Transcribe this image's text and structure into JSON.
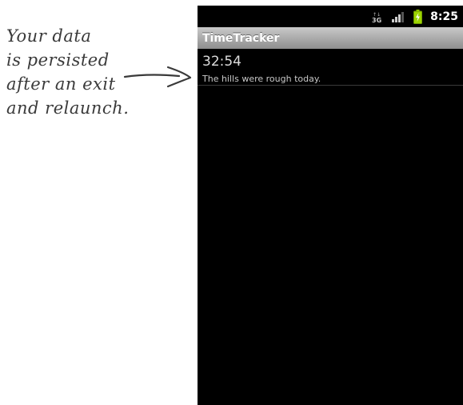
{
  "annotation": {
    "lines": [
      "Your data",
      "is persisted",
      "after an exit",
      "and relaunch."
    ]
  },
  "status_bar": {
    "network_label": "3G",
    "time": "8:25",
    "icons": [
      "3g-data-icon",
      "signal-strength-icon",
      "battery-charging-icon"
    ],
    "battery_color": "#9cd400"
  },
  "app": {
    "title": "TimeTracker"
  },
  "entries": [
    {
      "time": "32:54",
      "note": "The hills were rough today."
    }
  ]
}
